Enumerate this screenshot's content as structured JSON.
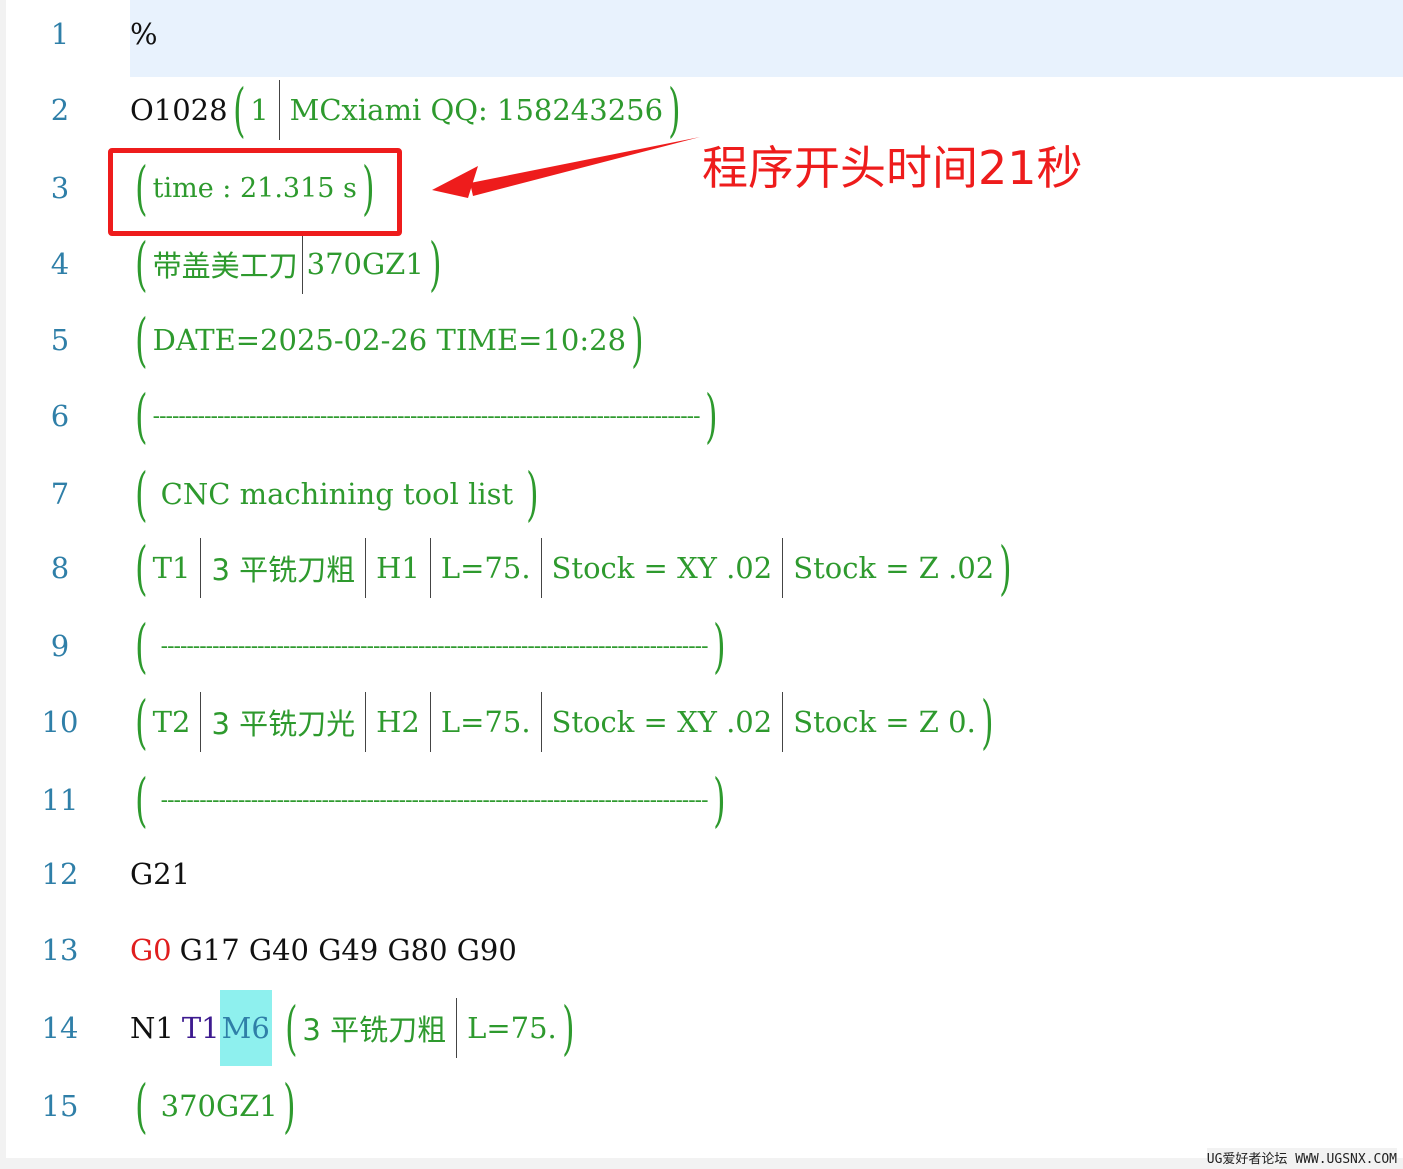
{
  "editor": {
    "lines": [
      {
        "n": "1"
      },
      {
        "n": "2",
        "t": {
          "a": "O1028",
          "b": "1",
          "c": "MCxiami QQ: 158243256"
        }
      },
      {
        "n": "3",
        "t": {
          "a": "time :  21.315 s"
        }
      },
      {
        "n": "4",
        "t": {
          "a": "带盖美工刀",
          "b": "370GZ1"
        }
      },
      {
        "n": "5",
        "t": {
          "a": "DATE=2025-02-26 TIME=10:28"
        }
      },
      {
        "n": "6",
        "t": {
          "a": "-------------------------------------------------------------------------------------"
        }
      },
      {
        "n": "7",
        "t": {
          "a": "CNC machining tool list"
        }
      },
      {
        "n": "8",
        "t": {
          "a": "T1",
          "b": "3 平铣刀粗",
          "c": "H1",
          "d": "L=75.",
          "e": "Stock = XY .02",
          "f": "Stock = Z .02"
        }
      },
      {
        "n": "9",
        "t": {
          "a": "-------------------------------------------------------------------------------------"
        }
      },
      {
        "n": "10",
        "t": {
          "a": "T2",
          "b": "3 平铣刀光",
          "c": "H2",
          "d": "L=75.",
          "e": "Stock = XY .02",
          "f": "Stock = Z 0."
        }
      },
      {
        "n": "11",
        "t": {
          "a": "-------------------------------------------------------------------------------------"
        }
      },
      {
        "n": "12",
        "t": {
          "a": "G21"
        }
      },
      {
        "n": "13",
        "t": {
          "a": "G0",
          "b": "G17 G40 G49 G80 G90"
        }
      },
      {
        "n": "14",
        "t": {
          "a": "N1",
          "b": "T1",
          "c": "M6",
          "d": "3 平铣刀粗",
          "e": "L=75."
        }
      },
      {
        "n": "15",
        "t": {
          "a": "370GZ1"
        }
      }
    ],
    "line1_text": "%"
  },
  "annotation": {
    "label": "程序开头时间21秒",
    "color": "#ee1c1c"
  },
  "watermark": "UG爱好者论坛 WWW.UGSNX.COM"
}
